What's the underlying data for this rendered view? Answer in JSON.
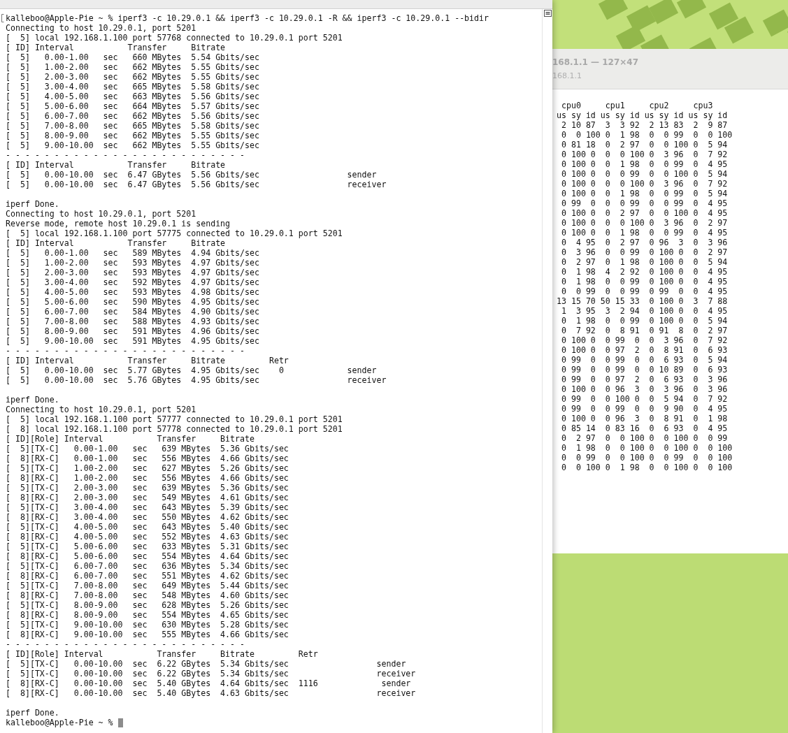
{
  "terminal": {
    "command": {
      "text": "kalleboo@Apple-Pie ~ % iperf3 -c 10.29.0.1 && iperf3 -c 10.29.0.1 -R && iperf3 -c 10.29.0.1 --bidir",
      "marked": true
    },
    "blocks": [
      [
        "Connecting to host 10.29.0.1, port 5201",
        "[  5] local 192.168.1.100 port 57768 connected to 10.29.0.1 port 5201",
        "[ ID] Interval           Transfer     Bitrate",
        "[  5]   0.00-1.00   sec   660 MBytes  5.54 Gbits/sec",
        "[  5]   1.00-2.00   sec   662 MBytes  5.55 Gbits/sec",
        "[  5]   2.00-3.00   sec   662 MBytes  5.55 Gbits/sec",
        "[  5]   3.00-4.00   sec   665 MBytes  5.58 Gbits/sec",
        "[  5]   4.00-5.00   sec   663 MBytes  5.56 Gbits/sec",
        "[  5]   5.00-6.00   sec   664 MBytes  5.57 Gbits/sec",
        "[  5]   6.00-7.00   sec   662 MBytes  5.56 Gbits/sec",
        "[  5]   7.00-8.00   sec   665 MBytes  5.58 Gbits/sec",
        "[  5]   8.00-9.00   sec   662 MBytes  5.55 Gbits/sec",
        "[  5]   9.00-10.00  sec   662 MBytes  5.55 Gbits/sec",
        "- - - - - - - - - - - - - - - - - - - - - - - - -",
        "[ ID] Interval           Transfer     Bitrate",
        "[  5]   0.00-10.00  sec  6.47 GBytes  5.56 Gbits/sec                  sender",
        "[  5]   0.00-10.00  sec  6.47 GBytes  5.56 Gbits/sec                  receiver"
      ],
      [
        "iperf Done.",
        "Connecting to host 10.29.0.1, port 5201",
        "Reverse mode, remote host 10.29.0.1 is sending",
        "[  5] local 192.168.1.100 port 57775 connected to 10.29.0.1 port 5201",
        "[ ID] Interval           Transfer     Bitrate",
        "[  5]   0.00-1.00   sec   589 MBytes  4.94 Gbits/sec",
        "[  5]   1.00-2.00   sec   593 MBytes  4.97 Gbits/sec",
        "[  5]   2.00-3.00   sec   593 MBytes  4.97 Gbits/sec",
        "[  5]   3.00-4.00   sec   592 MBytes  4.97 Gbits/sec",
        "[  5]   4.00-5.00   sec   593 MBytes  4.98 Gbits/sec",
        "[  5]   5.00-6.00   sec   590 MBytes  4.95 Gbits/sec",
        "[  5]   6.00-7.00   sec   584 MBytes  4.90 Gbits/sec",
        "[  5]   7.00-8.00   sec   588 MBytes  4.93 Gbits/sec",
        "[  5]   8.00-9.00   sec   591 MBytes  4.96 Gbits/sec",
        "[  5]   9.00-10.00  sec   591 MBytes  4.95 Gbits/sec",
        "- - - - - - - - - - - - - - - - - - - - - - - - -",
        "[ ID] Interval           Transfer     Bitrate         Retr",
        "[  5]   0.00-10.00  sec  5.77 GBytes  4.95 Gbits/sec    0             sender",
        "[  5]   0.00-10.00  sec  5.76 GBytes  4.95 Gbits/sec                  receiver"
      ],
      [
        "iperf Done.",
        "Connecting to host 10.29.0.1, port 5201",
        "[  5] local 192.168.1.100 port 57777 connected to 10.29.0.1 port 5201",
        "[  8] local 192.168.1.100 port 57778 connected to 10.29.0.1 port 5201",
        "[ ID][Role] Interval           Transfer     Bitrate",
        "[  5][TX-C]   0.00-1.00   sec   639 MBytes  5.36 Gbits/sec",
        "[  8][RX-C]   0.00-1.00   sec   556 MBytes  4.66 Gbits/sec",
        "[  5][TX-C]   1.00-2.00   sec   627 MBytes  5.26 Gbits/sec",
        "[  8][RX-C]   1.00-2.00   sec   556 MBytes  4.66 Gbits/sec",
        "[  5][TX-C]   2.00-3.00   sec   639 MBytes  5.36 Gbits/sec",
        "[  8][RX-C]   2.00-3.00   sec   549 MBytes  4.61 Gbits/sec",
        "[  5][TX-C]   3.00-4.00   sec   643 MBytes  5.39 Gbits/sec",
        "[  8][RX-C]   3.00-4.00   sec   550 MBytes  4.62 Gbits/sec",
        "[  5][TX-C]   4.00-5.00   sec   643 MBytes  5.40 Gbits/sec",
        "[  8][RX-C]   4.00-5.00   sec   552 MBytes  4.63 Gbits/sec",
        "[  5][TX-C]   5.00-6.00   sec   633 MBytes  5.31 Gbits/sec",
        "[  8][RX-C]   5.00-6.00   sec   554 MBytes  4.64 Gbits/sec",
        "[  5][TX-C]   6.00-7.00   sec   636 MBytes  5.34 Gbits/sec",
        "[  8][RX-C]   6.00-7.00   sec   551 MBytes  4.62 Gbits/sec",
        "[  5][TX-C]   7.00-8.00   sec   649 MBytes  5.44 Gbits/sec",
        "[  8][RX-C]   7.00-8.00   sec   548 MBytes  4.60 Gbits/sec",
        "[  5][TX-C]   8.00-9.00   sec   628 MBytes  5.26 Gbits/sec",
        "[  8][RX-C]   8.00-9.00   sec   554 MBytes  4.65 Gbits/sec",
        "[  5][TX-C]   9.00-10.00  sec   630 MBytes  5.28 Gbits/sec",
        "[  8][RX-C]   9.00-10.00  sec   555 MBytes  4.66 Gbits/sec",
        "- - - - - - - - - - - - - - - - - - - - - - - - -",
        "[ ID][Role] Interval           Transfer     Bitrate         Retr",
        "[  5][TX-C]   0.00-10.00  sec  6.22 GBytes  5.34 Gbits/sec                  sender",
        "[  5][TX-C]   0.00-10.00  sec  6.22 GBytes  5.34 Gbits/sec                  receiver",
        "[  8][RX-C]   0.00-10.00  sec  5.40 GBytes  4.64 Gbits/sec  1116             sender",
        "[  8][RX-C]   0.00-10.00  sec  5.40 GBytes  4.63 Gbits/sec                  receiver"
      ],
      [
        "iperf Done."
      ]
    ],
    "prompt": {
      "text": "kalleboo@Apple-Pie ~ % ",
      "cursor": true
    }
  },
  "background_window": {
    "title": "168.1.1 — 127×47",
    "subtitle": "168.1.1",
    "lines": [
      " cpu0     cpu1     cpu2     cpu3",
      "us sy id us sy id us sy id us sy id",
      " 2 10 87  3  3 92  2 13 83  2  9 87",
      " 0  0 100 0  1 98  0  0 99  0  0 100",
      " 0 81 18  0  2 97  0  0 100 0  5 94",
      " 0 100 0  0  0 100 0  3 96  0  7 92",
      " 0 100 0  0  1 98  0  0 99  0  4 95",
      " 0 100 0  0  0 99  0  0 100 0  5 94",
      " 0 100 0  0  0 100 0  3 96  0  7 92",
      " 0 100 0  0  1 98  0  0 99  0  5 94",
      " 0 99  0  0  0 99  0  0 99  0  4 95",
      " 0 100 0  0  2 97  0  0 100 0  4 95",
      " 0 100 0  0  0 100 0  3 96  0  2 97",
      " 0 100 0  0  1 98  0  0 99  0  4 95",
      " 0  4 95  0  2 97  0 96  3  0  3 96",
      " 0  3 96  0  0 99  0 100 0  0  2 97",
      " 0  2 97  0  1 98  0 100 0  0  5 94",
      " 0  1 98  4  2 92  0 100 0  0  4 95",
      " 0  1 98  0  0 99  0 100 0  0  4 95",
      " 0  0 99  0  0 99  0 99  0  0  4 95",
      "13 15 70 50 15 33  0 100 0  3  7 88",
      " 1  3 95  3  2 94  0 100 0  0  4 95",
      " 0  1 98  0  0 99  0 100 0  0  5 94",
      " 0  7 92  0  8 91  0 91  8  0  2 97",
      " 0 100 0  0 99  0  0  3 96  0  7 92",
      " 0 100 0  0 97  2  0  8 91  0  6 93",
      " 0 99  0  0 99  0  0  6 93  0  5 94",
      " 0 99  0  0 99  0  0 10 89  0  6 93",
      " 0 99  0  0 97  2  0  6 93  0  3 96",
      " 0 100 0  0 96  3  0  3 96  0  3 96",
      " 0 99  0  0 100 0  0  5 94  0  7 92",
      " 0 99  0  0 99  0  0  9 90  0  4 95",
      " 0 100 0  0 96  3  0  8 91  0  1 98",
      " 0 85 14  0 83 16  0  6 93  0  4 95",
      " 0  2 97  0  0 100 0  0 100 0  0 99",
      " 0  1 98  0  0 100 0  0 100 0  0 100",
      " 0  0 99  0  0 100 0  0 99  0  0 100",
      " 0  0 100 0  1 98  0  0 100 0  0 100"
    ]
  }
}
